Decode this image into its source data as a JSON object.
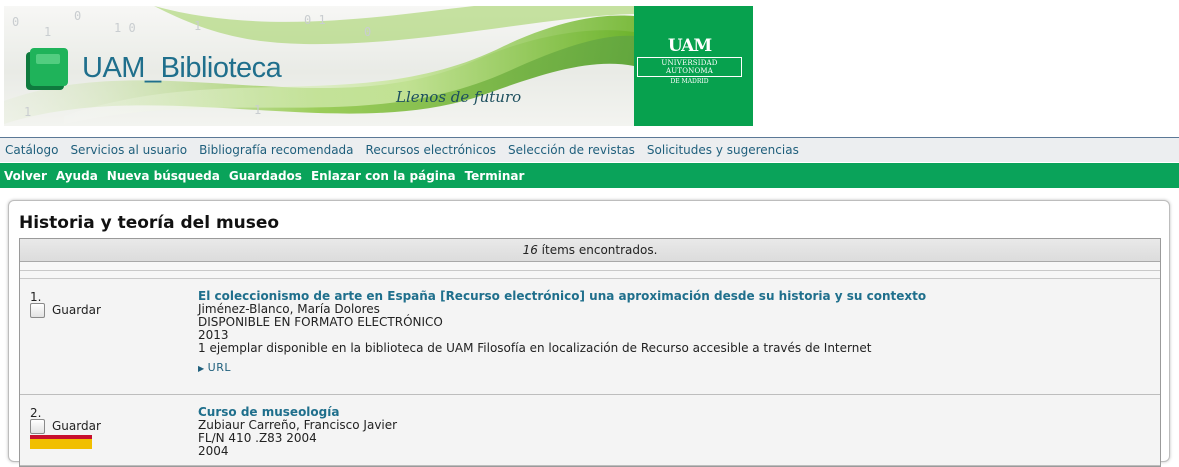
{
  "banner": {
    "logo_text": "UAM_Biblioteca",
    "tagline": "Llenos de futuro",
    "seal_mark": "UAM",
    "seal_line1": "UNIVERSIDAD AUTONOMA",
    "seal_line2": "DE MADRID",
    "colors": {
      "green": "#07a14e",
      "blue": "#1f6f8c"
    }
  },
  "nav_primary": [
    "Catálogo",
    "Servicios al usuario",
    "Bibliografía recomendada",
    "Recursos electrónicos",
    "Selección de revistas",
    "Solicitudes y sugerencias"
  ],
  "nav_secondary": [
    "Volver",
    "Ayuda",
    "Nueva búsqueda",
    "Guardados",
    "Enlazar con la página",
    "Terminar"
  ],
  "main": {
    "title": "Historia y teoría del museo",
    "count_number": "16",
    "count_text": " ítems encontrados."
  },
  "records": [
    {
      "number": "1.",
      "save_label": "Guardar",
      "title": "El coleccionismo de arte en España [Recurso electrónico] una aproximación desde su historia y su contexto",
      "author": "Jiménez-Blanco, María Dolores",
      "format": "DISPONIBLE EN FORMATO ELECTRÓNICO",
      "year": "2013",
      "availability": "1 ejemplar disponible en la biblioteca de UAM Filosofía en localización de Recurso accesible a través de Internet",
      "link_label": "URL"
    },
    {
      "number": "2.",
      "save_label": "Guardar",
      "title": "Curso de museología",
      "author": "Zubiaur Carreño, Francisco Javier",
      "call_number": "FL/N 410 .Z83 2004",
      "year": "2004"
    }
  ]
}
